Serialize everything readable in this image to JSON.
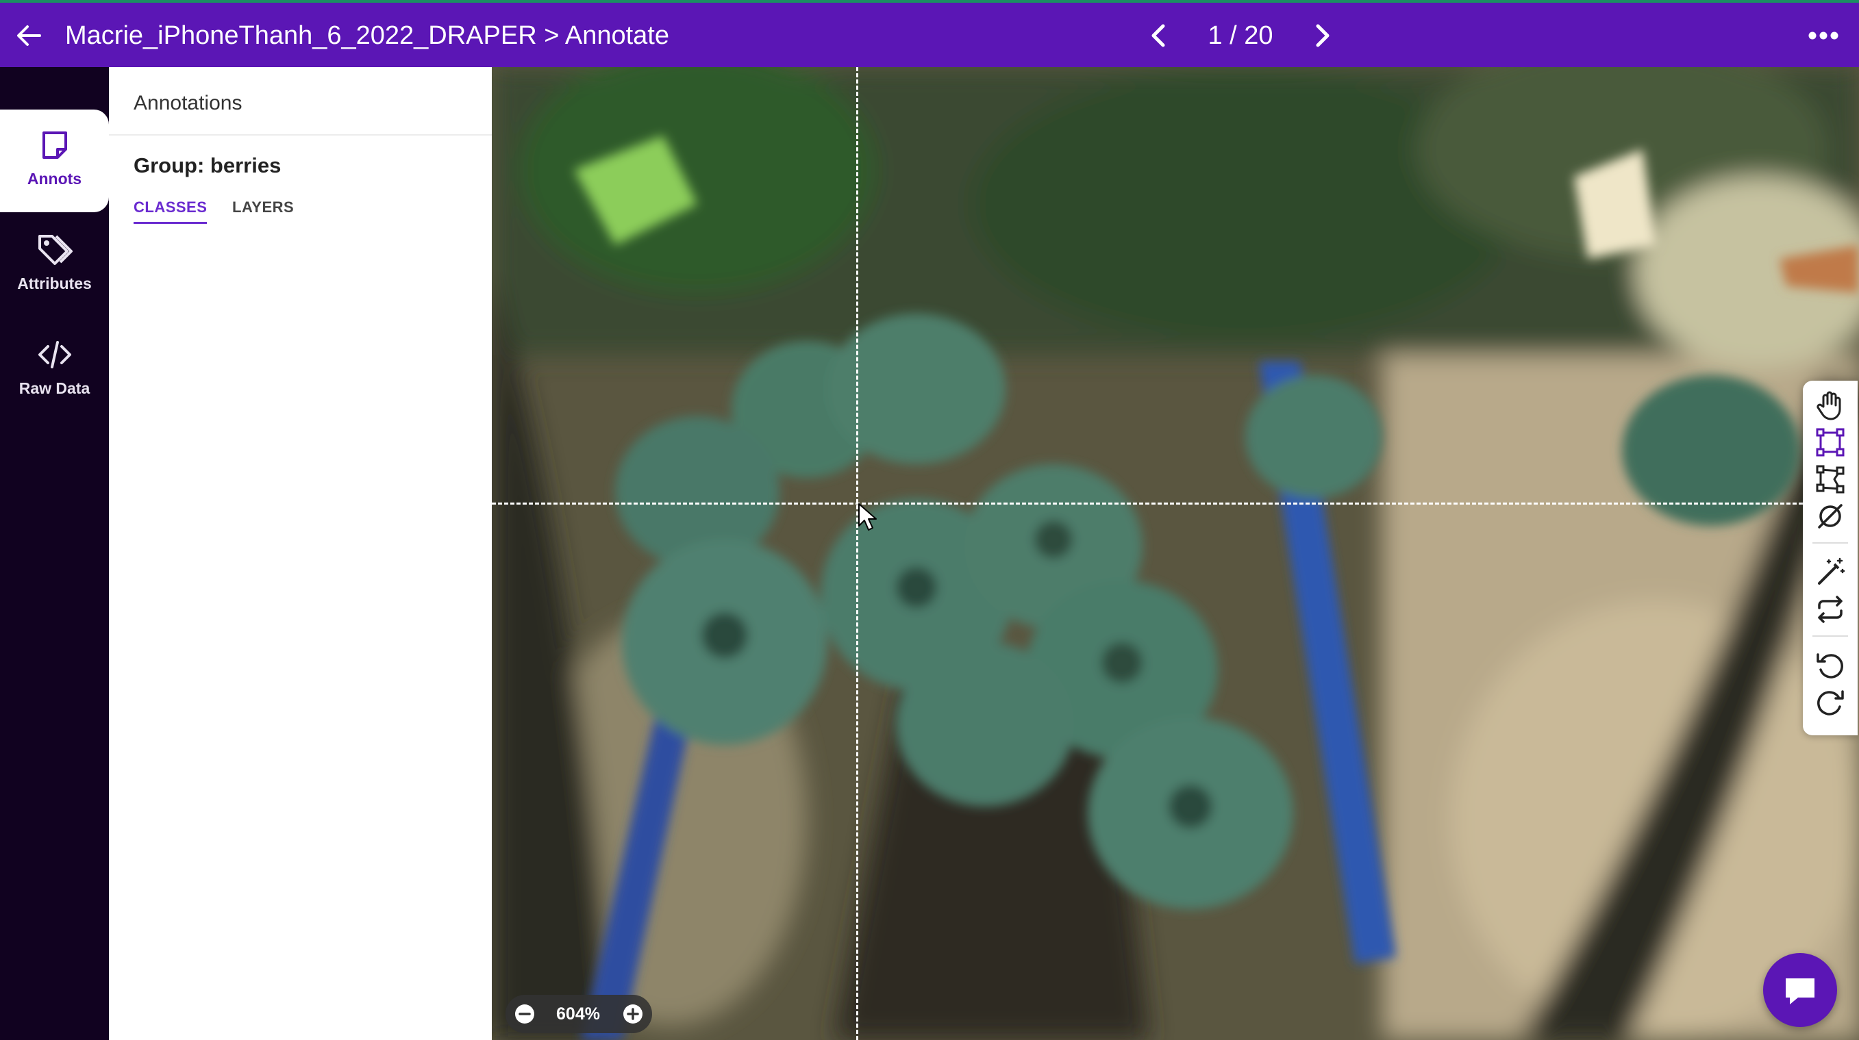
{
  "header": {
    "title": "Macrie_iPhoneThanh_6_2022_DRAPER > Annotate",
    "page_counter": "1 / 20",
    "icons": [
      "arrow-left-icon",
      "chevron-left-icon",
      "chevron-right-icon",
      "more-horizontal-icon"
    ]
  },
  "sidebar": {
    "items": [
      {
        "label": "Annots",
        "icon": "note-icon",
        "active": true
      },
      {
        "label": "Attributes",
        "icon": "tags-icon",
        "active": false
      },
      {
        "label": "Raw Data",
        "icon": "code-icon",
        "active": false
      }
    ]
  },
  "panel": {
    "title": "Annotations",
    "group_title": "Group: berries",
    "tabs": [
      {
        "label": "CLASSES",
        "active": true
      },
      {
        "label": "LAYERS",
        "active": false
      }
    ]
  },
  "viewer": {
    "zoom_level": "604%",
    "tools": [
      "pan-hand-icon",
      "bounding-box-icon",
      "polygon-icon",
      "hide-annotations-icon",
      "magic-wand-icon",
      "swap-icon",
      "undo-icon",
      "redo-icon"
    ]
  },
  "colors": {
    "topbar": "#5b16b5",
    "sidebar": "#110220",
    "accent": "#6a2bd0",
    "top_border": "#1b8e62"
  }
}
